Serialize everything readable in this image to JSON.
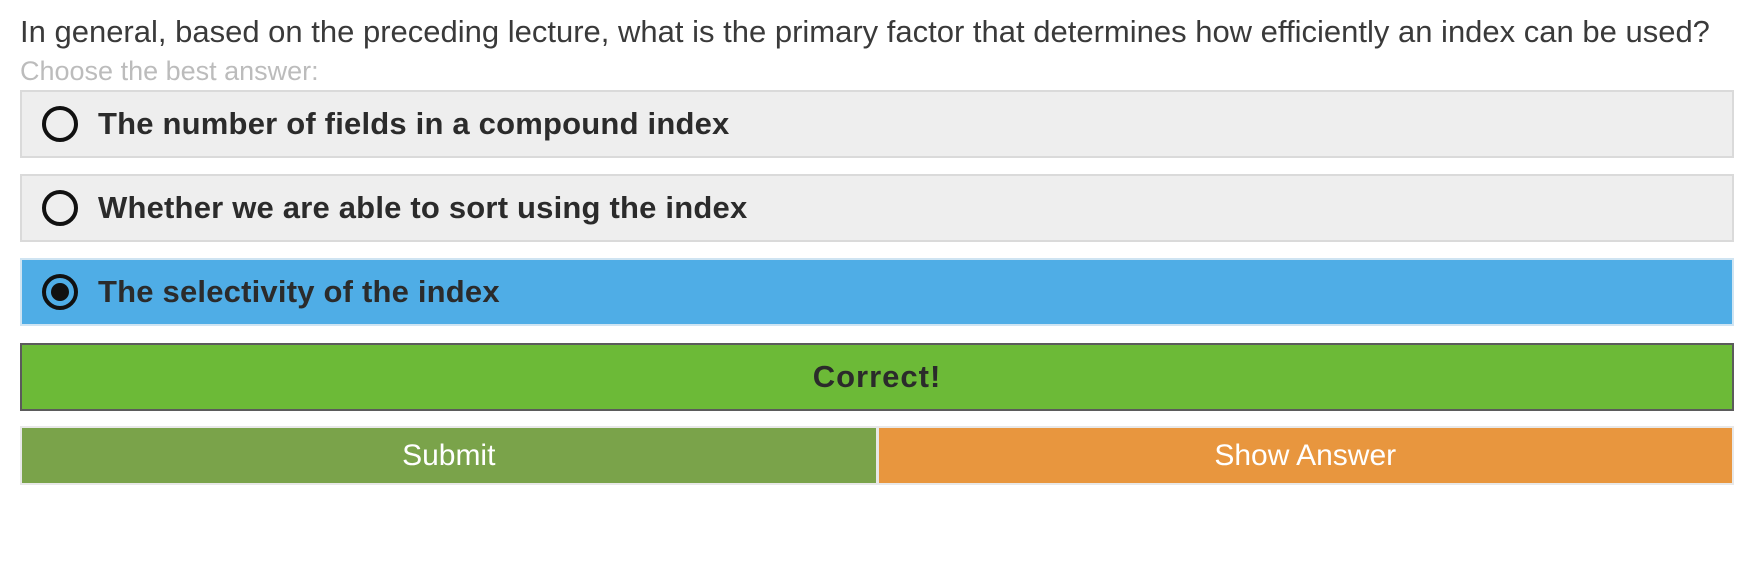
{
  "question": {
    "text": "In general, based on the preceding lecture, what is the primary factor that determines how efficiently an index can be used?",
    "instructions": "Choose the best answer:"
  },
  "options": [
    {
      "label": "The number of fields in a compound index",
      "selected": false
    },
    {
      "label": "Whether we are able to sort using the index",
      "selected": false
    },
    {
      "label": "The selectivity of the index",
      "selected": true
    }
  ],
  "result": {
    "text": "Correct!"
  },
  "buttons": {
    "submit_label": "Submit",
    "show_answer_label": "Show Answer"
  },
  "colors": {
    "selected_option": "#4fade6",
    "correct_banner": "#6cba37",
    "submit_button": "#7aa34a",
    "show_answer_button": "#e8963e"
  }
}
